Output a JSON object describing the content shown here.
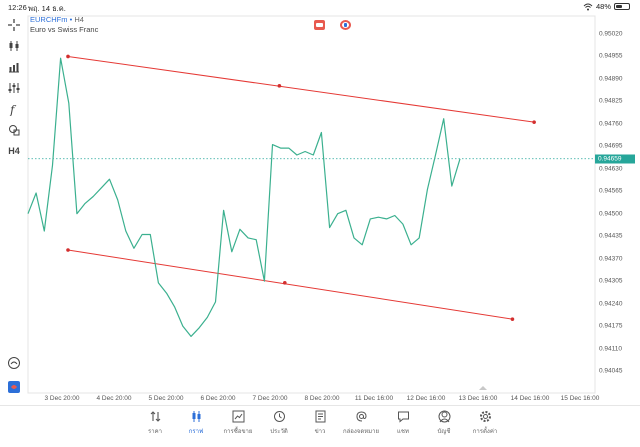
{
  "status_bar": {
    "time": "12:26",
    "date": "พฤ. 14 ธ.ค.",
    "battery": "48%"
  },
  "instrument": {
    "symbol": "EURCHFm",
    "separator": "•",
    "timeframe": "H4",
    "description": "Euro vs Swiss Franc"
  },
  "toolbar": {
    "items": [
      {
        "name": "crosshair-icon"
      },
      {
        "name": "indicators-icon"
      },
      {
        "name": "bar-chart-icon"
      },
      {
        "name": "settings-sliders-icon"
      },
      {
        "name": "function-icon"
      },
      {
        "name": "shapes-icon"
      },
      {
        "name": "timeframe-label",
        "label": "H4"
      }
    ],
    "bottom": [
      {
        "name": "bug-icon"
      },
      {
        "name": "logo-icon"
      }
    ]
  },
  "price_axis": {
    "ticks": [
      "0.95020",
      "0.94955",
      "0.94890",
      "0.94825",
      "0.94760",
      "0.94695",
      "0.94630",
      "0.94565",
      "0.94500",
      "0.94435",
      "0.94370",
      "0.94305",
      "0.94240",
      "0.94175",
      "0.94110",
      "0.94045"
    ],
    "current_price": "0.94659"
  },
  "time_axis": {
    "ticks": [
      "3 Dec 20:00",
      "4 Dec 20:00",
      "5 Dec 20:00",
      "6 Dec 20:00",
      "7 Dec 20:00",
      "8 Dec 20:00",
      "11 Dec 16:00",
      "12 Dec 16:00",
      "13 Dec 16:00",
      "14 Dec 16:00",
      "15 Dec 16:00"
    ]
  },
  "chart_data": {
    "type": "line",
    "price_min": 0.94045,
    "price_max": 0.9502,
    "close": [
      0.945,
      0.9456,
      0.9445,
      0.9464,
      0.9495,
      0.9482,
      0.945,
      0.9453,
      0.9455,
      0.94575,
      0.946,
      0.9454,
      0.9445,
      0.944,
      0.9444,
      0.9444,
      0.943,
      0.9427,
      0.9423,
      0.94175,
      0.94145,
      0.9417,
      0.942,
      0.94245,
      0.9451,
      0.9439,
      0.94455,
      0.9443,
      0.94425,
      0.94305,
      0.947,
      0.9469,
      0.9469,
      0.9467,
      0.9468,
      0.9467,
      0.94735,
      0.9446,
      0.945,
      0.9451,
      0.9443,
      0.9441,
      0.94485,
      0.9449,
      0.94485,
      0.94495,
      0.9447,
      0.9441,
      0.9443,
      0.9457,
      0.9467,
      0.94775,
      0.9458,
      0.94659
    ],
    "trendlines": [
      {
        "color": "#e53935",
        "points": [
          [
            0,
            0.94955
          ],
          [
            39,
            0.9487
          ],
          [
            86,
            0.94765
          ]
        ]
      },
      {
        "color": "#e53935",
        "points": [
          [
            0,
            0.94395
          ],
          [
            40,
            0.943
          ],
          [
            82,
            0.94195
          ]
        ]
      }
    ],
    "line_color": "#3bb08f"
  },
  "tab_bar": {
    "tabs": [
      {
        "name": "tab-quotes",
        "icon": "arrows-updown-icon",
        "label": "ราคา",
        "active": false
      },
      {
        "name": "tab-chart",
        "icon": "candles-icon",
        "label": "กราฟ",
        "active": true
      },
      {
        "name": "tab-trade",
        "icon": "trend-icon",
        "label": "การซื้อขาย",
        "active": false
      },
      {
        "name": "tab-history",
        "icon": "clock-icon",
        "label": "ประวัติ",
        "active": false
      },
      {
        "name": "tab-news",
        "icon": "news-icon",
        "label": "ข่าว",
        "active": false
      },
      {
        "name": "tab-mailbox",
        "icon": "at-icon",
        "label": "กล่องจดหมาย",
        "active": false
      },
      {
        "name": "tab-chat",
        "icon": "chat-icon",
        "label": "แชท",
        "active": false
      },
      {
        "name": "tab-accounts",
        "icon": "user-icon",
        "label": "บัญชี",
        "active": false
      },
      {
        "name": "tab-settings",
        "icon": "gear-icon",
        "label": "การตั้งค่า",
        "active": false
      }
    ]
  },
  "colors": {
    "accent": "#2c6fd8",
    "price_line": "#26a69a",
    "trendline": "#e53935",
    "chart_line": "#3bb08f"
  }
}
